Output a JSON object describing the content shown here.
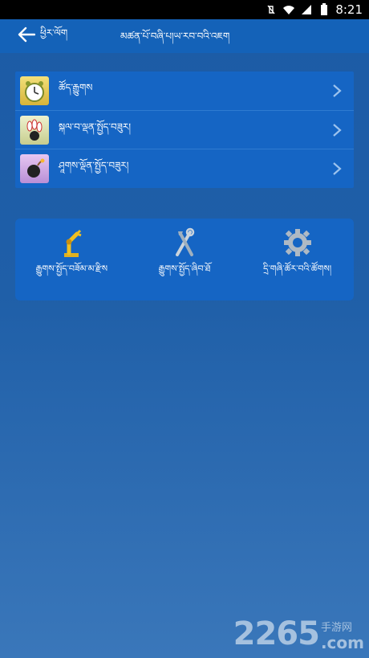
{
  "status_bar": {
    "time": "8:21"
  },
  "app_bar": {
    "back_label": "ཕྱིར་ལོག",
    "title": "མཚན་པོ་བཞི་པ།ཡ་རབ་བའི་འཇག"
  },
  "menu": {
    "items": [
      {
        "label": "ཚོད་རྒྱུགས",
        "icon": "alarm-clock-icon"
      },
      {
        "label": "སྐལ་བ་ལྡན་སྤྱོད་བཟུར།",
        "icon": "bowling-icon"
      },
      {
        "label": "ཤཱགས་ལྡོན་སྤྱོད་བཟུར།",
        "icon": "bomb-icon"
      }
    ]
  },
  "tools": [
    {
      "label": "རྒྱུགས་སྤྱོད་བཟོམ་མ་རྫིས",
      "icon": "robot-arm-icon"
    },
    {
      "label": "རྒྱུགས་སྤྱོད་ཞིབ་ཐོ",
      "icon": "wrench-icon"
    },
    {
      "label": "དྲི་གཞི་ཚོར་བའི་ཚོགས།",
      "icon": "gear-icon"
    }
  ],
  "watermark": {
    "number": "2265",
    "chinese": "手游网",
    "domain": ".com"
  },
  "colors": {
    "app_bar": "#1462b8",
    "card": "#1565c4"
  }
}
